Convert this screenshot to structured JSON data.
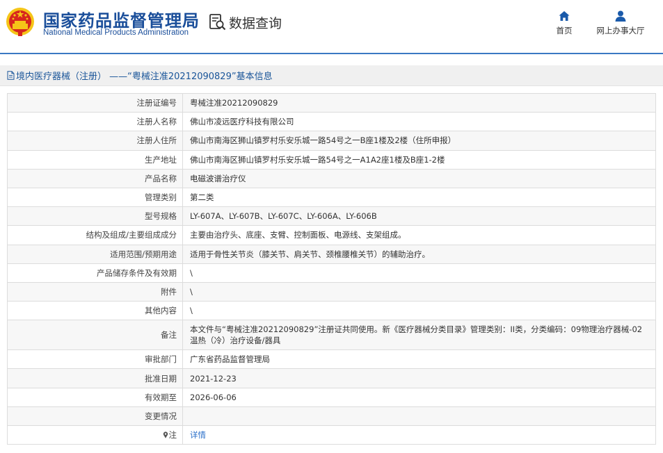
{
  "header": {
    "org_cn": "国家药品监督管理局",
    "org_en": "National Medical Products Administration",
    "section_title": "数据查询",
    "nav": [
      {
        "label": "首页",
        "icon": "home-icon"
      },
      {
        "label": "网上办事大厅",
        "icon": "user-icon"
      }
    ]
  },
  "breadcrumb": {
    "text": "境内医疗器械（注册） ——“粤械注准20212090829”基本信息"
  },
  "colors": {
    "brand_blue": "#1a4e9a",
    "link_blue": "#2a6fc9",
    "divider_blue": "#3a78c3",
    "emblem_red": "#d7261e",
    "emblem_gold": "#f5c518"
  },
  "record": {
    "rows": [
      {
        "label": "注册证编号",
        "value": "粤械注准20212090829"
      },
      {
        "label": "注册人名称",
        "value": "佛山市凌远医疗科技有限公司"
      },
      {
        "label": "注册人住所",
        "value": "佛山市南海区狮山镇罗村乐安乐城一路54号之一B座1楼及2楼（住所申报）"
      },
      {
        "label": "生产地址",
        "value": "佛山市南海区狮山镇罗村乐安乐城一路54号之一A1A2座1楼及B座1-2楼"
      },
      {
        "label": "产品名称",
        "value": "电磁波谱治疗仪"
      },
      {
        "label": "管理类别",
        "value": "第二类"
      },
      {
        "label": "型号规格",
        "value": "LY-607A、LY-607B、LY-607C、LY-606A、LY-606B"
      },
      {
        "label": "结构及组成/主要组成成分",
        "value": "主要由治疗头、底座、支臂、控制面板、电源线、支架组成。"
      },
      {
        "label": "适用范围/预期用途",
        "value": "适用于骨性关节炎（膝关节、肩关节、颈椎腰椎关节）的辅助治疗。"
      },
      {
        "label": "产品储存条件及有效期",
        "value": "\\"
      },
      {
        "label": "附件",
        "value": "\\"
      },
      {
        "label": "其他内容",
        "value": "\\"
      },
      {
        "label": "备注",
        "value": "本文件与“粤械注准20212090829”注册证共同使用。新《医疗器械分类目录》管理类别：II类，分类编码：09物理治疗器械-02温热（冷）治疗设备/器具"
      },
      {
        "label": "审批部门",
        "value": "广东省药品监督管理局"
      },
      {
        "label": "批准日期",
        "value": "2021-12-23"
      },
      {
        "label": "有效期至",
        "value": "2026-06-06"
      },
      {
        "label": "变更情况",
        "value": ""
      },
      {
        "label": "注",
        "value": "详情",
        "icon": "pin-icon"
      }
    ]
  }
}
